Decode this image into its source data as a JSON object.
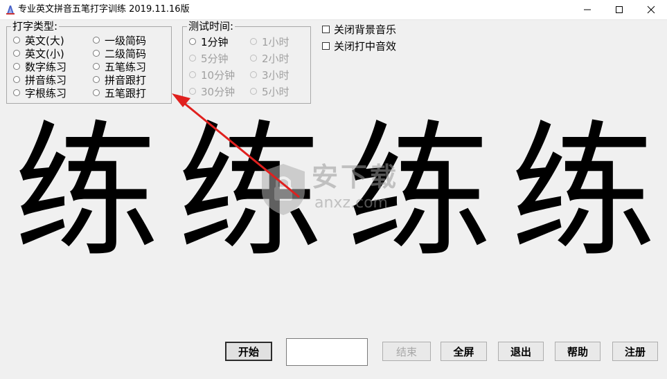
{
  "window": {
    "title": "专业英文拼音五笔打字训练  2019.11.16版"
  },
  "type_group": {
    "legend": "打字类型:",
    "options": [
      {
        "label": "英文(大)"
      },
      {
        "label": "英文(小)"
      },
      {
        "label": "数字练习"
      },
      {
        "label": "拼音练习"
      },
      {
        "label": "字根练习"
      },
      {
        "label": "一级简码"
      },
      {
        "label": "二级简码"
      },
      {
        "label": "五笔练习"
      },
      {
        "label": "拼音跟打"
      },
      {
        "label": "五笔跟打"
      }
    ]
  },
  "time_group": {
    "legend": "测试时间:",
    "options": [
      {
        "label": "1分钟",
        "enabled": true
      },
      {
        "label": "5分钟",
        "enabled": false
      },
      {
        "label": "10分钟",
        "enabled": false
      },
      {
        "label": "30分钟",
        "enabled": false
      },
      {
        "label": "1小时",
        "enabled": false
      },
      {
        "label": "2小时",
        "enabled": false
      },
      {
        "label": "3小时",
        "enabled": false
      },
      {
        "label": "5小时",
        "enabled": false
      }
    ]
  },
  "options": {
    "bg_music": "关闭背景音乐",
    "hit_sound": "关闭打中音效"
  },
  "practice": {
    "chars": [
      "练",
      "练",
      "练",
      "练"
    ]
  },
  "watermark": {
    "text": "安下载",
    "sub": "anxz.com"
  },
  "buttons": {
    "start": "开始",
    "end": "结束",
    "fullscreen": "全屏",
    "exit": "退出",
    "help": "帮助",
    "register": "注册"
  },
  "colors": {
    "arrow": "#e0201e"
  }
}
